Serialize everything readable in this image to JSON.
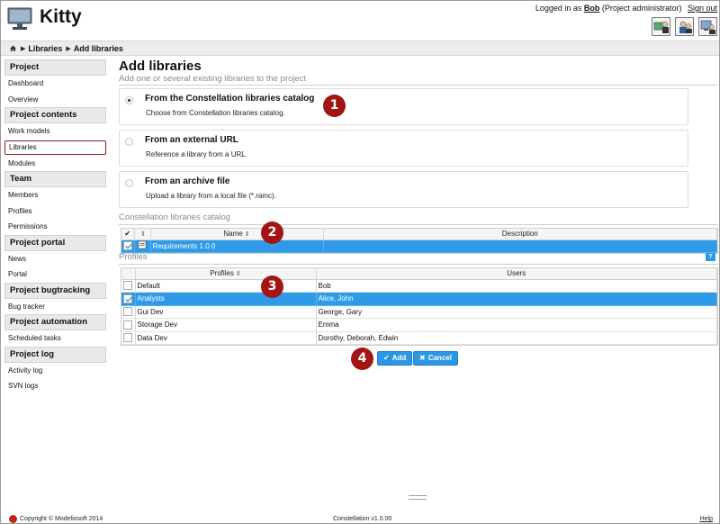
{
  "app": {
    "title": "Kitty"
  },
  "login": {
    "prefix": "Logged in as",
    "user": "Bob",
    "role": "(Project administrator)",
    "signout": "Sign out"
  },
  "top_icons": [
    "project-admin-icon",
    "user-admin-icon",
    "system-admin-icon"
  ],
  "breadcrumb": {
    "home_icon": "home-icon",
    "items": [
      "Libraries",
      "Add libraries"
    ]
  },
  "sidebar": {
    "groups": [
      {
        "title": "Project",
        "items": [
          "Dashboard",
          "Overview"
        ]
      },
      {
        "title": "Project contents",
        "items": [
          "Work models",
          "Libraries",
          "Modules"
        ]
      },
      {
        "title": "Team",
        "items": [
          "Members",
          "Profiles",
          "Permissions"
        ]
      },
      {
        "title": "Project portal",
        "items": [
          "News",
          "Portal"
        ]
      },
      {
        "title": "Project bugtracking",
        "items": [
          "Bug tracker"
        ]
      },
      {
        "title": "Project automation",
        "items": [
          "Scheduled tasks"
        ]
      },
      {
        "title": "Project log",
        "items": [
          "Activity log",
          "SVN logs"
        ]
      }
    ],
    "active": "Libraries"
  },
  "main": {
    "title": "Add libraries",
    "subtitle": "Add one or several existing libraries to the project",
    "options": [
      {
        "title": "From the Constellation libraries catalog",
        "desc": "Choose from Constellation libraries catalog.",
        "selected": true
      },
      {
        "title": "From an external URL",
        "desc": "Reference a library from a URL.",
        "selected": false
      },
      {
        "title": "From an archive file",
        "desc": "Upload a library from a local file (*.ramc).",
        "selected": false
      }
    ],
    "catalog": {
      "label": "Constellation libraries catalog",
      "columns": {
        "name": "Name",
        "description": "Description"
      },
      "rows": [
        {
          "name": "Requirements 1.0.0",
          "description": "",
          "checked": true
        }
      ]
    },
    "profiles": {
      "label": "Profiles",
      "help": "?",
      "columns": {
        "profiles": "Profiles",
        "users": "Users"
      },
      "rows": [
        {
          "profile": "Default",
          "users": "Bob",
          "checked": false
        },
        {
          "profile": "Analysts",
          "users": "Alice, John",
          "checked": true
        },
        {
          "profile": "Gui Dev",
          "users": "George, Gary",
          "checked": false
        },
        {
          "profile": "Storage Dev",
          "users": "Emma",
          "checked": false
        },
        {
          "profile": "Data Dev",
          "users": "Dorothy, Deborah, Edwin",
          "checked": false
        }
      ]
    },
    "buttons": {
      "add": "Add",
      "cancel": "Cancel"
    }
  },
  "badges": [
    "1",
    "2",
    "3",
    "4"
  ],
  "footer": {
    "copyright": "Copyright © Modeliosoft 2014",
    "version": "Constellation v1.0.00",
    "help": "Help"
  },
  "colors": {
    "selection": "#2f9be8",
    "badge": "#a31515",
    "active_border": "#8b1a1a"
  }
}
